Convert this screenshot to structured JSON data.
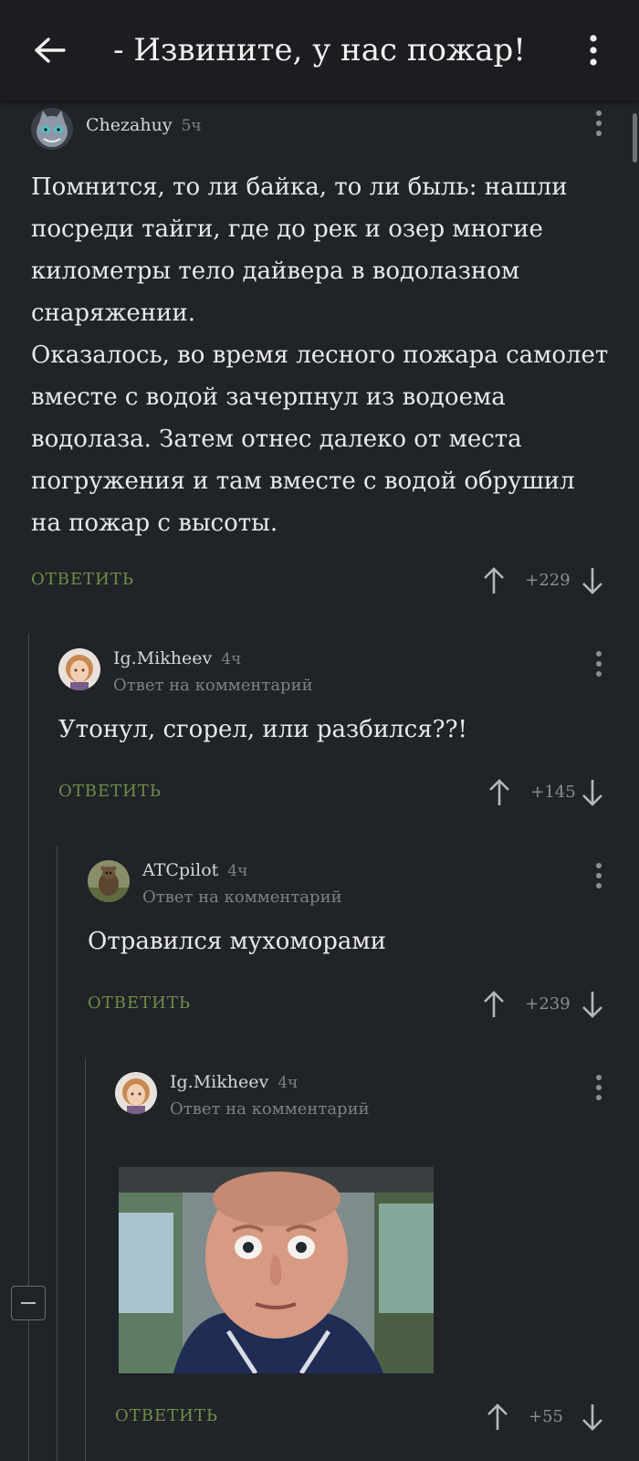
{
  "header": {
    "title": "- Извините, у нас пожар!",
    "back_icon": "arrow-left-icon",
    "menu_icon": "more-vertical-icon"
  },
  "comments": [
    {
      "author": "Chezahuy",
      "time": "5ч",
      "text_lines": [
        "Помнится, то ли байка, то ли быль: нашли",
        "посреди тайги, где до рек и озер многие",
        "километры тело дайвера в водолазном",
        "снаряжении.",
        "Оказалось, во время лесного пожара самолет",
        "вместе с водой зачерпнул из водоема",
        "водолаза. Затем отнес далеко от места",
        "погружения и там вместе с водой обрушил",
        "на пожар с высоты."
      ],
      "reply_label": "ОТВЕТИТЬ",
      "score": "+229"
    },
    {
      "author": "Ig.Mikheev",
      "time": "4ч",
      "reply_note": "Ответ на комментарий",
      "text": "Утонул, сгорел, или разбился??!",
      "reply_label": "ОТВЕТИТЬ",
      "score": "+145"
    },
    {
      "author": "ATCpilot",
      "time": "4ч",
      "reply_note": "Ответ на комментарий",
      "text": "Отравился мухоморами",
      "reply_label": "ОТВЕТИТЬ",
      "score": "+239"
    },
    {
      "author": "Ig.Mikheev",
      "time": "4ч",
      "reply_note": "Ответ на комментарий",
      "image": "photo-surprised-man-in-car",
      "reply_label": "ОТВЕТИТЬ",
      "score": "+55"
    }
  ],
  "icons": {
    "vote_up": "arrow-up-icon",
    "vote_down": "arrow-down-icon",
    "comment_menu": "more-vertical-icon",
    "collapse": "collapse-thread-icon"
  },
  "colors": {
    "background": "#202327",
    "header": "#1b1d20",
    "reply_link": "#6f8d48",
    "muted_text": "#7c8086"
  }
}
